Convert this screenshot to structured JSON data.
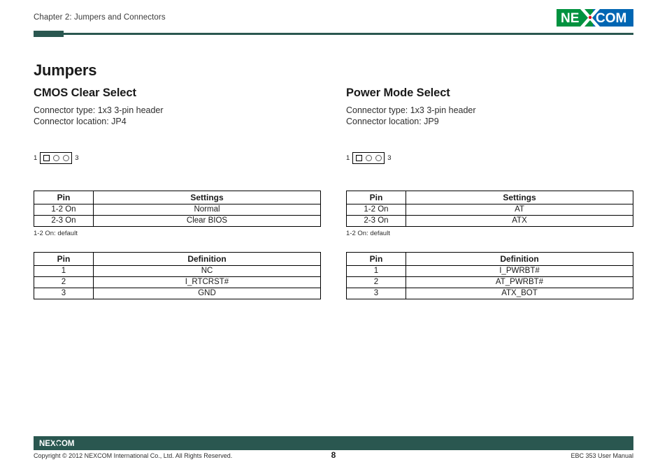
{
  "header": {
    "chapter": "Chapter 2: Jumpers and Connectors",
    "logo_left_text": "NE",
    "logo_right_text": "COM",
    "logo_name": "NEXCOM"
  },
  "page_title": "Jumpers",
  "sections": [
    {
      "title": "CMOS Clear Select",
      "connector_type": "Connector type: 1x3 3-pin header",
      "connector_location": "Connector location: JP4",
      "diagram": {
        "start_label": "1",
        "end_label": "3"
      },
      "settings_table": {
        "headers": [
          "Pin",
          "Settings"
        ],
        "rows": [
          [
            "1-2 On",
            "Normal"
          ],
          [
            "2-3 On",
            "Clear BIOS"
          ]
        ],
        "note": "1-2 On: default"
      },
      "definition_table": {
        "headers": [
          "Pin",
          "Definition"
        ],
        "rows": [
          [
            "1",
            "NC"
          ],
          [
            "2",
            "I_RTCRST#"
          ],
          [
            "3",
            "GND"
          ]
        ]
      }
    },
    {
      "title": "Power Mode Select",
      "connector_type": "Connector type: 1x3 3-pin header",
      "connector_location": "Connector location: JP9",
      "diagram": {
        "start_label": "1",
        "end_label": "3"
      },
      "settings_table": {
        "headers": [
          "Pin",
          "Settings"
        ],
        "rows": [
          [
            "1-2 On",
            "AT"
          ],
          [
            "2-3 On",
            "ATX"
          ]
        ],
        "note": "1-2 On: default"
      },
      "definition_table": {
        "headers": [
          "Pin",
          "Definition"
        ],
        "rows": [
          [
            "1",
            "I_PWRBT#"
          ],
          [
            "2",
            "AT_PWRBT#"
          ],
          [
            "3",
            "ATX_BOT"
          ]
        ]
      }
    }
  ],
  "footer": {
    "logo_text": "NEXCOM",
    "copyright": "Copyright © 2012 NEXCOM International Co., Ltd. All Rights Reserved.",
    "page_number": "8",
    "manual_name": "EBC 353 User Manual"
  },
  "colors": {
    "brand_green": "#2a5750",
    "logo_green": "#00923f",
    "logo_blue": "#0066b3",
    "logo_red": "#e3001b"
  }
}
